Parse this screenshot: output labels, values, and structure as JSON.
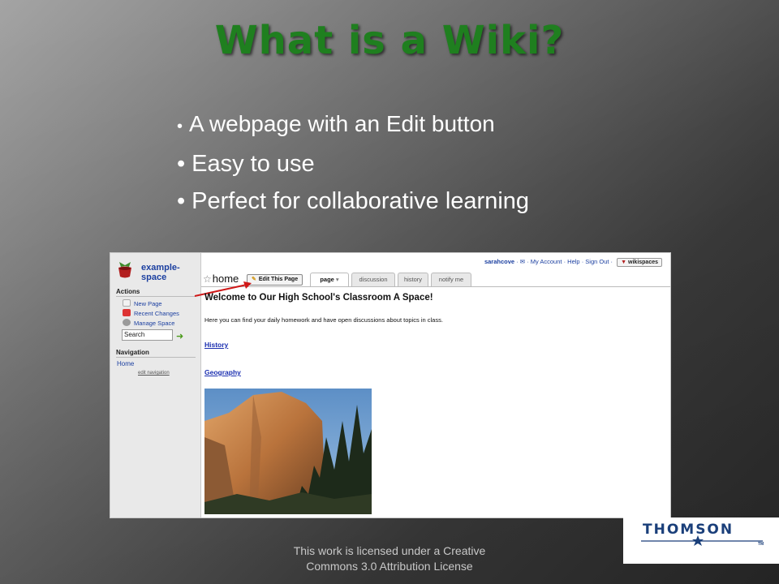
{
  "slide": {
    "title": "What is a Wiki?",
    "bullets": [
      "A webpage with an Edit button",
      "Easy to use",
      "Perfect for collaborative learning"
    ],
    "bullet_glyph": "•",
    "footer": {
      "line1": "This work is licensed under a Creative",
      "line2": "Commons 3.0 Attribution License"
    },
    "logo_text": "THOMSON",
    "logo_tm": "TM",
    "colors": {
      "title": "#1f7f1f",
      "bullets": "#ffffff",
      "logo": "#1a3f7a"
    }
  },
  "wiki": {
    "space_name": "example-space",
    "top_links": {
      "user": "sarahcove",
      "sep1": " · ",
      "mail_icon": "✉",
      "sep2": " · ",
      "my_account": "My Account",
      "sep3": " · ",
      "help": "Help",
      "sep4": " · ",
      "sign_out": "Sign Out",
      "sep5": " · ",
      "wikispaces": "wikispaces"
    },
    "sidebar": {
      "actions_heading": "Actions",
      "new_page": "New Page",
      "recent_changes": "Recent Changes",
      "manage_space": "Manage Space",
      "search_value": "Search",
      "navigation_heading": "Navigation",
      "home": "Home",
      "edit_navigation": "edit navigation"
    },
    "page_title": "home",
    "edit_button": "Edit This Page",
    "tabs": {
      "page": "page",
      "page_caret": "▾",
      "discussion": "discussion",
      "history": "history",
      "notify_me": "notify me"
    },
    "welcome": "Welcome to Our High School's Classroom A Space!",
    "intro": "Here you can find your daily homework and have open discussions about topics in class.",
    "links": {
      "history": "History",
      "geography": "Geography"
    }
  }
}
